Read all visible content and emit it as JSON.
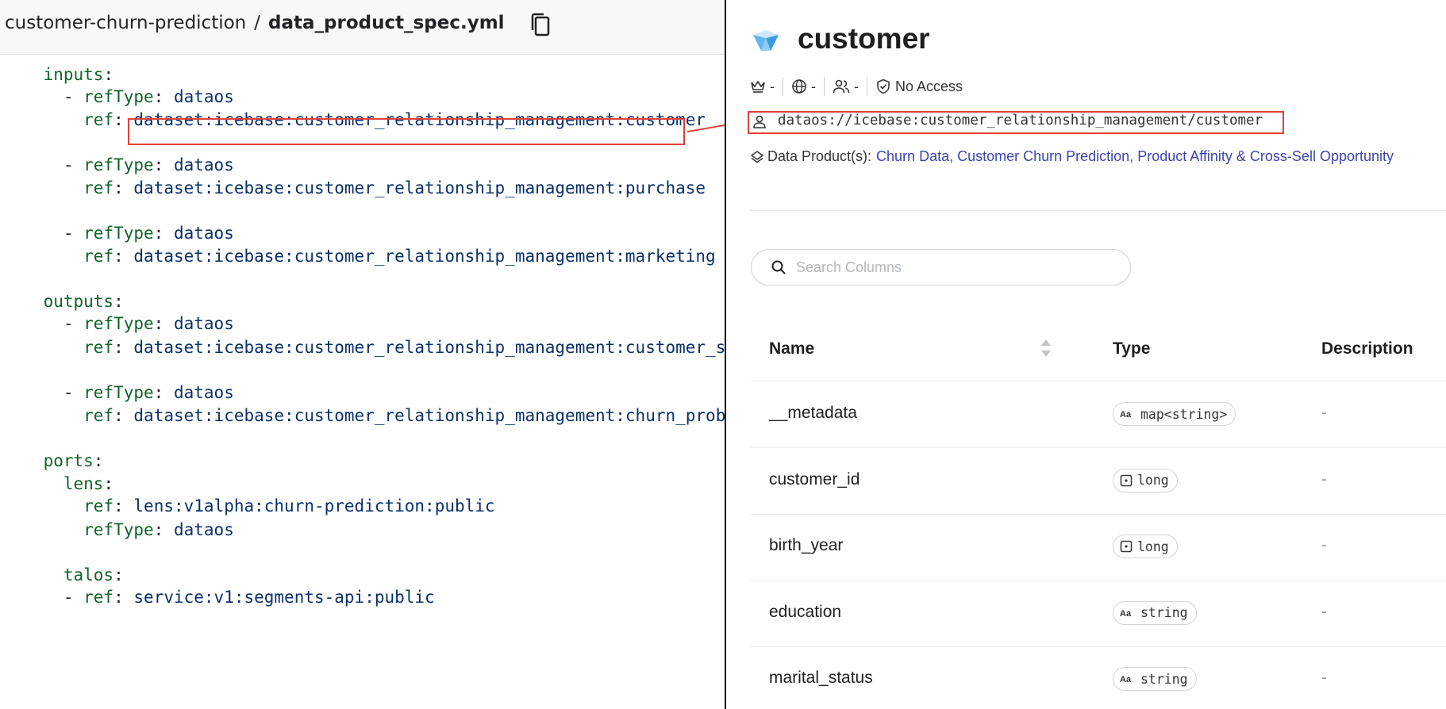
{
  "left": {
    "breadcrumb": {
      "repo": "customer-churn-prediction",
      "separator": "/",
      "file": "data_product_spec.yml"
    },
    "code_lines": [
      {
        "indent": "    ",
        "dash": "",
        "key": "inputs",
        "value": ""
      },
      {
        "indent": "      ",
        "dash": "- ",
        "key": "refType",
        "value": "dataos"
      },
      {
        "indent": "        ",
        "dash": "",
        "key": "ref",
        "value": "dataset:icebase:customer_relationship_management:customer"
      },
      {
        "indent": "      ",
        "dash": "- ",
        "key": "refType",
        "value": "dataos"
      },
      {
        "indent": "        ",
        "dash": "",
        "key": "ref",
        "value": "dataset:icebase:customer_relationship_management:purchase"
      },
      {
        "indent": "      ",
        "dash": "- ",
        "key": "refType",
        "value": "dataos"
      },
      {
        "indent": "        ",
        "dash": "",
        "key": "ref",
        "value": "dataset:icebase:customer_relationship_management:marketing"
      },
      {
        "indent": "    ",
        "dash": "",
        "key": "outputs",
        "value": ""
      },
      {
        "indent": "      ",
        "dash": "- ",
        "key": "refType",
        "value": "dataos"
      },
      {
        "indent": "        ",
        "dash": "",
        "key": "ref",
        "value": "dataset:icebase:customer_relationship_management:customer_segm"
      },
      {
        "indent": "      ",
        "dash": "- ",
        "key": "refType",
        "value": "dataos"
      },
      {
        "indent": "        ",
        "dash": "",
        "key": "ref",
        "value": "dataset:icebase:customer_relationship_management:churn_probabi"
      },
      {
        "indent": "    ",
        "dash": "",
        "key": "ports",
        "value": ""
      },
      {
        "indent": "      ",
        "dash": "",
        "key": "lens",
        "value": ""
      },
      {
        "indent": "        ",
        "dash": "",
        "key": "ref",
        "value": "lens:v1alpha:churn-prediction:public"
      },
      {
        "indent": "        ",
        "dash": "",
        "key": "refType",
        "value": "dataos"
      },
      {
        "indent": "      ",
        "dash": "",
        "key": "talos",
        "value": ""
      },
      {
        "indent": "      ",
        "dash": "- ",
        "key": "ref",
        "value": "service:v1:segments-api:public"
      }
    ]
  },
  "right": {
    "title": "customer",
    "meta": {
      "owner": "-",
      "domain": "-",
      "users": "-",
      "access": "No Access"
    },
    "urn": "dataos://icebase:customer_relationship_management/customer",
    "data_products": {
      "label": "Data Product(s):",
      "links": "Churn Data, Customer Churn Prediction, Product Affinity & Cross-Sell Opportunity"
    },
    "search": {
      "placeholder": "Search Columns"
    },
    "table": {
      "headers": {
        "name": "Name",
        "type": "Type",
        "description": "Description"
      },
      "rows": [
        {
          "name": "__metadata",
          "type": "map<string>",
          "type_icon": "text-type-icon",
          "description": "-"
        },
        {
          "name": "customer_id",
          "type": "long",
          "type_icon": "number-type-icon",
          "description": "-"
        },
        {
          "name": "birth_year",
          "type": "long",
          "type_icon": "number-type-icon",
          "description": "-"
        },
        {
          "name": "education",
          "type": "string",
          "type_icon": "text-type-icon",
          "description": "-"
        },
        {
          "name": "marital_status",
          "type": "string",
          "type_icon": "text-type-icon",
          "description": "-"
        }
      ]
    }
  },
  "colors": {
    "highlight": "#e0413a",
    "yaml_key": "#116329",
    "yaml_value": "#0a3069",
    "link": "#3b44b0"
  }
}
